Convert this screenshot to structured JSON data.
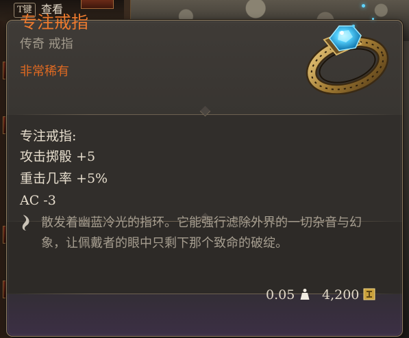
{
  "hud": {
    "key_label": "T键",
    "view_label": "查看"
  },
  "item": {
    "name": "专注戒指",
    "type": "传奇 戒指",
    "rarity": "非常稀有",
    "rarity_color": "#e06a22",
    "name_color": "#ec7a2e",
    "icon": "sapphire-ring-icon"
  },
  "stats": {
    "header": "专注戒指:",
    "lines": [
      "攻击掷骰 +5",
      "重击几率 +5%",
      "AC -3"
    ]
  },
  "description": {
    "icon": "quote-mark-icon",
    "text": "散发着幽蓝冷光的指环。它能强行滤除外界的一切杂音与幻象，让佩戴者的眼中只剩下那个致命的破绽。"
  },
  "footer": {
    "weight": "0.05",
    "weight_icon": "weight-icon",
    "price": "4,200",
    "price_icon": "gold-coin-icon"
  }
}
